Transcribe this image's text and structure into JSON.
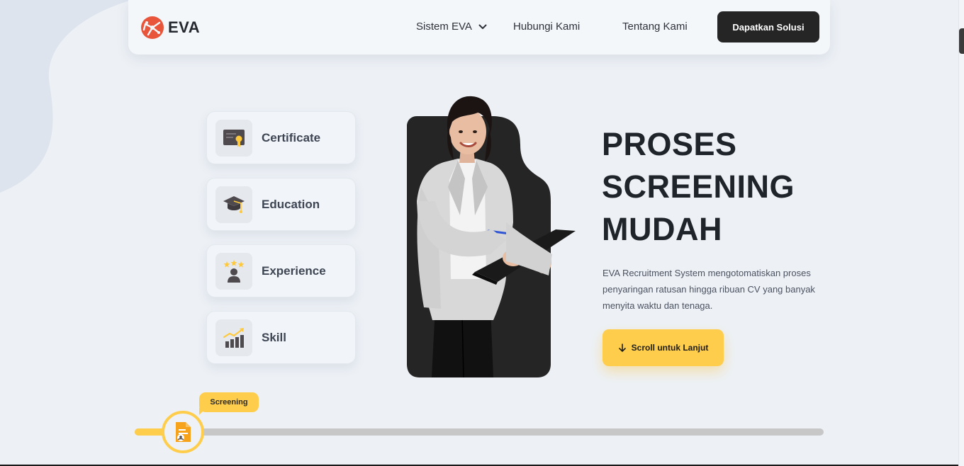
{
  "navbar": {
    "logo_text": "EVA",
    "items": [
      {
        "label": "Sistem EVA",
        "has_dropdown": true
      },
      {
        "label": "Hubungi Kami"
      },
      {
        "label": "Tentang Kami"
      }
    ],
    "cta_label": "Dapatkan Solusi"
  },
  "features": [
    {
      "label": "Certificate",
      "icon": "certificate-icon"
    },
    {
      "label": "Education",
      "icon": "graduation-cap-icon"
    },
    {
      "label": "Experience",
      "icon": "person-stars-icon"
    },
    {
      "label": "Skill",
      "icon": "growth-chart-icon"
    }
  ],
  "hero": {
    "title_lines": [
      "PROSES",
      "SCREENING",
      "MUDAH"
    ],
    "description": "EVA Recruitment System mengotomatiskan proses penyaringan ratusan hingga ribuan CV yang banyak menyita waktu dan tenaga.",
    "scroll_button_label": "Scroll untuk Lanjut"
  },
  "progress": {
    "stage_label": "Screening",
    "stage_icon": "document-user-icon"
  },
  "colors": {
    "accent_yellow": "#ffcd4c",
    "dark": "#252525",
    "background": "#edf1f6",
    "logo_orange": "#e8553a"
  }
}
